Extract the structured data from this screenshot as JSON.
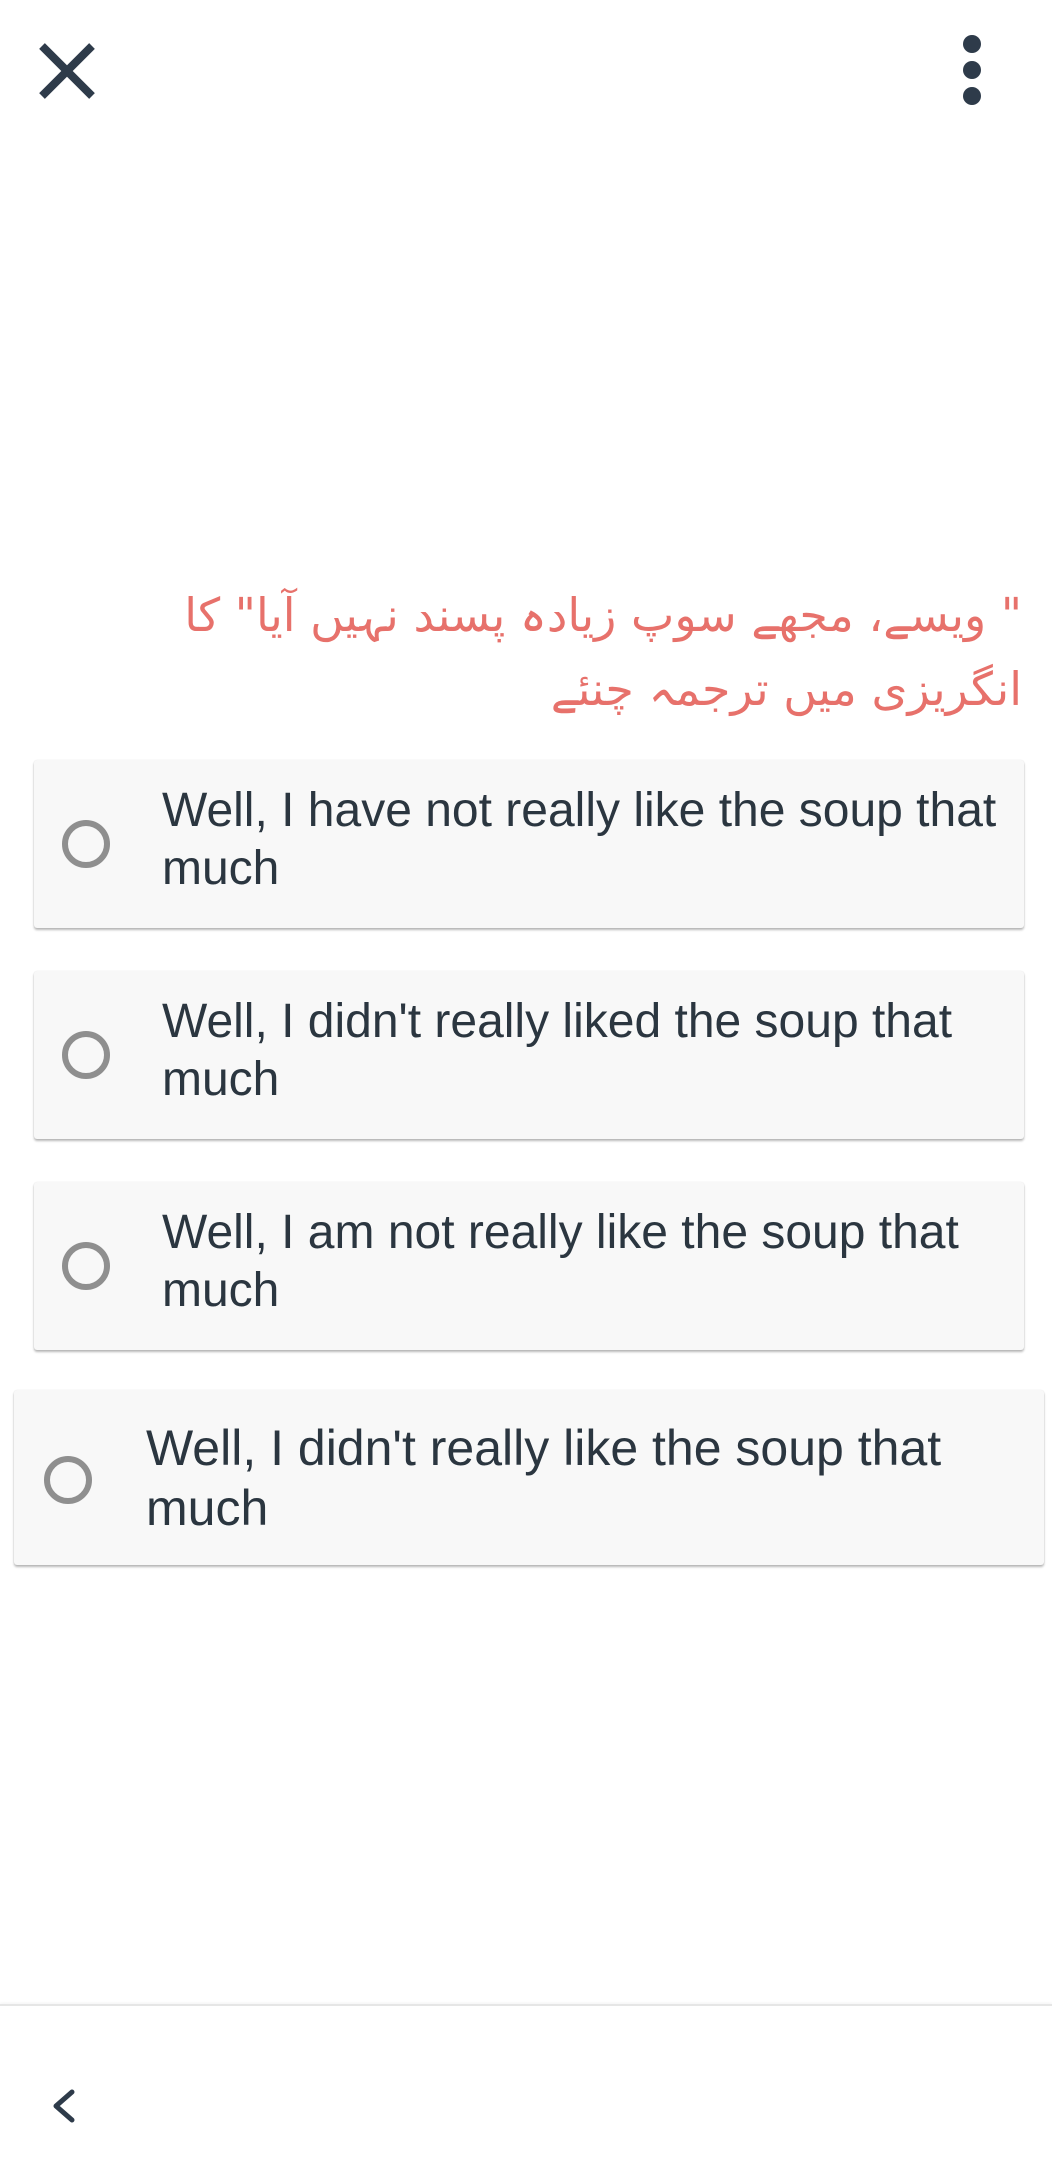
{
  "header": {
    "close_icon": "close-icon",
    "more_icon": "more-vertical-icon"
  },
  "question": {
    "text": "\" ویسے، مجھے سوپ زیادہ پسند نہیں آیا\" کا انگریزی میں ترجمہ چنئے"
  },
  "options": [
    {
      "label": "Well, I have not really like the soup that much",
      "selected": false
    },
    {
      "label": "Well, I didn't really liked the soup that much",
      "selected": false
    },
    {
      "label": "Well, I am not really like the soup that much",
      "selected": false
    },
    {
      "label": "Well, I didn't really like the soup that much",
      "selected": false
    }
  ],
  "footer": {
    "back_icon": "chevron-left-icon"
  },
  "colors": {
    "question_text": "#e7716b",
    "option_text": "#2b3640",
    "radio_border": "#8f8f8f",
    "card_background": "#f8f8f8",
    "icon_dark": "#2e3b4a"
  }
}
